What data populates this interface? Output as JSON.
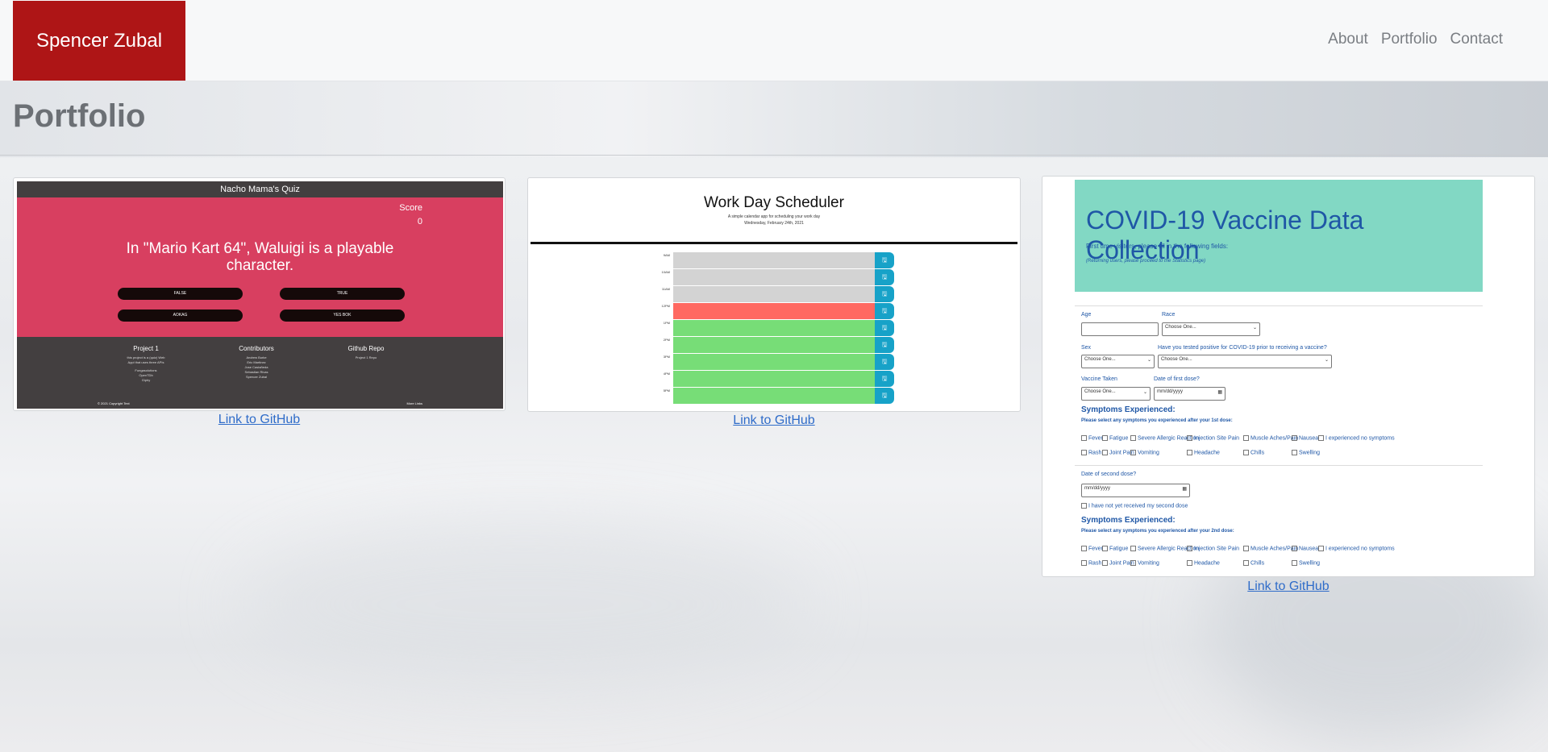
{
  "navbar": {
    "brand": "Spencer Zubal",
    "links": [
      "About",
      "Portfolio",
      "Contact"
    ]
  },
  "page_title": "Portfolio",
  "colors": {
    "brand": "#ae1516",
    "link": "#2f6cc9",
    "quiz_pink": "#d83f60",
    "quiz_dark": "#433f40",
    "covid_teal": "#82d8c4"
  },
  "projects": [
    {
      "link": "Link to GitHub",
      "quiz": {
        "header": "Nacho Mama's Quiz",
        "score_label": "Score",
        "score": "0",
        "question": "In \"Mario Kart 64\", Waluigi is a playable character.",
        "answers": [
          "FALSE",
          "TRUE",
          "AOKAG",
          "YES BOK"
        ],
        "footer": {
          "col1_title": "Project 1",
          "col1_text": [
            "this project is a (quiz) Web",
            "Appl that uses three APIs",
            "",
            "Fungasolutions",
            "OpenTDb",
            "Giphy"
          ],
          "col2_title": "Contributors",
          "col2_text": [
            "Andrew Burke",
            "Eric Martinez",
            "Jose Castañeda",
            "Sebastian Rivas",
            "Spencer Zubal"
          ],
          "col3_title": "Github Repo",
          "col3_text": [
            "Project 1 Repo"
          ],
          "copyright": "© 2021 Copyright Text",
          "more": "More Links"
        }
      }
    },
    {
      "link": "Link to GitHub",
      "scheduler": {
        "title": "Work Day Scheduler",
        "subtitle": "A simple calendar app for scheduling your work day",
        "date": "Wednesday, February 24th, 2021",
        "hours": [
          "9AM",
          "10AM",
          "11AM",
          "12PM",
          "1PM",
          "2PM",
          "3PM",
          "4PM",
          "5PM"
        ],
        "states": [
          "past",
          "past",
          "past",
          "present",
          "future",
          "future",
          "future",
          "future",
          "future"
        ],
        "state_colors": {
          "past": "#d3d3d3",
          "present": "#ff6961",
          "future": "#77dd77"
        },
        "save_icon": "save-icon"
      }
    },
    {
      "link": "Link to GitHub",
      "covid": {
        "title": "COVID-19 Vaccine Data Collection",
        "intro": "First time visitors, please fill in the following fields:",
        "returning": "(Returning users, please proceed to the Statistics page)",
        "age_label": "Age",
        "race_label": "Race",
        "race_value": "Choose One...",
        "sex_label": "Sex",
        "sex_value": "Choose One...",
        "tested_label": "Have you tested positive for COVID-19 prior to receiving a vaccine?",
        "tested_value": "Choose One...",
        "vaccine_label": "Vaccine Taken",
        "vaccine_value": "Choose One...",
        "first_dose_label": "Date of first dose?",
        "first_dose_placeholder": "mm/dd/yyyy",
        "symptoms_title": "Symptoms Experienced:",
        "symptoms_first": "Please select any symptoms you experienced after your 1st dose:",
        "symptoms_row1": [
          "Fever",
          "Fatigue",
          "Severe Allergic Reaction",
          "Injection Site Pain",
          "Muscle Aches/Pain",
          "Nausea",
          "I experienced no symptoms"
        ],
        "symptoms_row2": [
          "Rash",
          "Joint Pain",
          "Vomiting",
          "Headache",
          "Chills",
          "Swelling"
        ],
        "second_dose_label": "Date of second dose?",
        "second_dose_placeholder": "mm/dd/yyyy",
        "no_second": "I have not yet received my second dose",
        "symptoms_second": "Please select any symptoms you experienced after your 2nd dose:"
      }
    }
  ]
}
